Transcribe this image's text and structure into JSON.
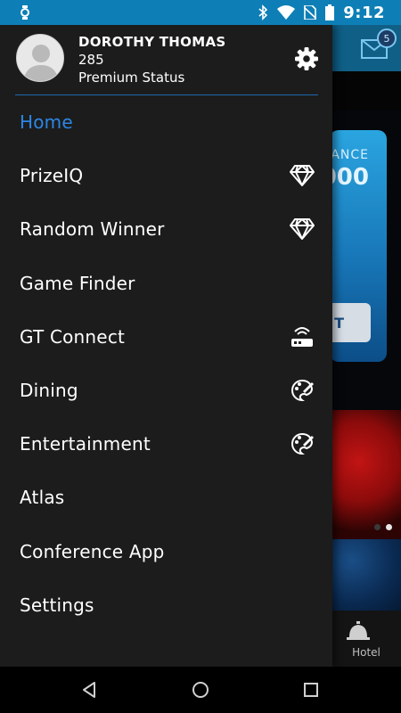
{
  "status_bar": {
    "time": "9:12",
    "icons": [
      "watch-icon",
      "bluetooth-icon",
      "wifi-icon",
      "no-sim-icon",
      "battery-icon"
    ]
  },
  "background_app": {
    "mail_badge": "5",
    "balance_label": "ANCE",
    "balance_value": "000",
    "balance_button": "T",
    "bottom_tab_label": "Hotel",
    "accent_color": "#0e7fb6"
  },
  "drawer": {
    "profile": {
      "name": "DOROTHY THOMAS",
      "points": "285",
      "status": "Premium Status"
    },
    "items": [
      {
        "label": "Home",
        "icon": "",
        "active": true
      },
      {
        "label": "PrizeIQ",
        "icon": "diamond-icon"
      },
      {
        "label": "Random Winner",
        "icon": "diamond-icon"
      },
      {
        "label": "Game Finder",
        "icon": ""
      },
      {
        "label": "GT Connect",
        "icon": "router-icon"
      },
      {
        "label": "Dining",
        "icon": "palette-icon"
      },
      {
        "label": "Entertainment",
        "icon": "palette-icon"
      },
      {
        "label": "Atlas",
        "icon": ""
      },
      {
        "label": "Conference App",
        "icon": ""
      },
      {
        "label": "Settings",
        "icon": ""
      }
    ],
    "active_color": "#2c86e4",
    "divider_color": "#1f67b0"
  },
  "nav_bar": {
    "buttons": [
      "back-icon",
      "home-icon",
      "recents-icon"
    ]
  }
}
